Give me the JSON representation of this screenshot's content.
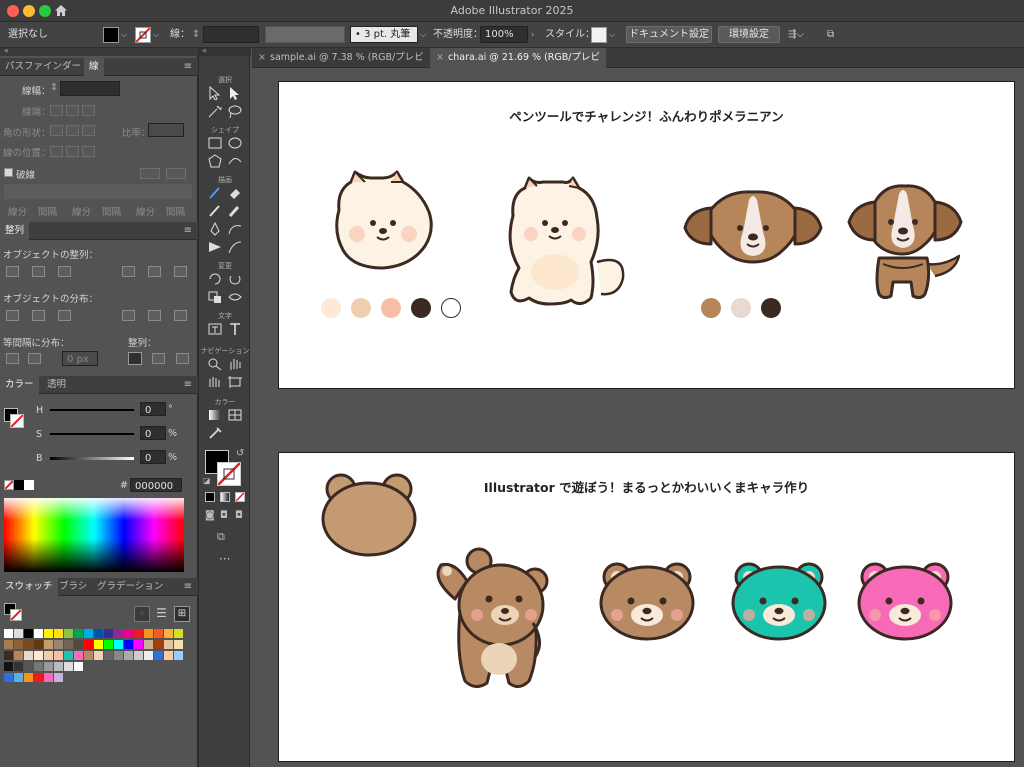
{
  "window": {
    "title": "Adobe Illustrator 2025"
  },
  "control": {
    "selection": "選択なし",
    "stroke_label": "線：",
    "brush": "3 pt. 丸筆",
    "opacity_label": "不透明度：",
    "opacity_value": "100%",
    "style_label": "スタイル：",
    "doc_settings": "ドキュメント設定",
    "prefs": "環境設定"
  },
  "stroke_panel": {
    "tabs": [
      "パスファインダー",
      "線"
    ],
    "weight_label": "線幅：",
    "cap_label": "線端：",
    "corner_label": "角の形状：",
    "limit_label": "比率：",
    "align_label": "線の位置：",
    "dashed_label": "破線",
    "dash_cells": [
      "線分",
      "間隔",
      "線分",
      "間隔",
      "線分",
      "間隔"
    ]
  },
  "align_panel": {
    "tab": "整列",
    "align_objects": "オブジェクトの整列：",
    "distribute_objects": "オブジェクトの分布：",
    "distribute_spacing": "等間隔に分布：",
    "align_to": "整列：",
    "spacing_value": "0 px"
  },
  "color_panel": {
    "tabs": [
      "カラー",
      "透明"
    ],
    "h_label": "H",
    "h_value": "0",
    "h_unit": "°",
    "s_label": "S",
    "s_value": "0",
    "s_unit": "%",
    "b_label": "B",
    "b_value": "0",
    "b_unit": "%",
    "hash": "#",
    "hex": "000000"
  },
  "swatch_panel": {
    "tabs": [
      "スウォッチ",
      "ブラシ",
      "グラデーション"
    ]
  },
  "toolbar": {
    "groups": [
      "選択",
      "シェイプ",
      "描画",
      "変更",
      "文字",
      "ナビゲーション",
      "カラー"
    ]
  },
  "doc_tabs": [
    "sample.ai @ 7.38 % (RGB/プレビュー)",
    "chara.ai @ 21.69 % (RGB/プレビュー)"
  ],
  "artboards": [
    {
      "title": "ペンツールでチャレンジ！ふんわりポメラニアン",
      "palette1": [
        "#fde9d6",
        "#efcfb0",
        "#f7bfa3",
        "#3c2a22",
        "#ffffff"
      ],
      "palette2": [
        "#b6865a",
        "#e8d9d2",
        "#3c2a22"
      ]
    },
    {
      "title": "Illustrator で遊ぼう！まるっとかわいいくまキャラ作り",
      "bear_colors": [
        "#b88a63",
        "#1cc4ad",
        "#f76ab8"
      ]
    }
  ],
  "colors": {
    "accent": "#2f72d6",
    "panel": "#535353",
    "dark": "#3c3c3c"
  }
}
